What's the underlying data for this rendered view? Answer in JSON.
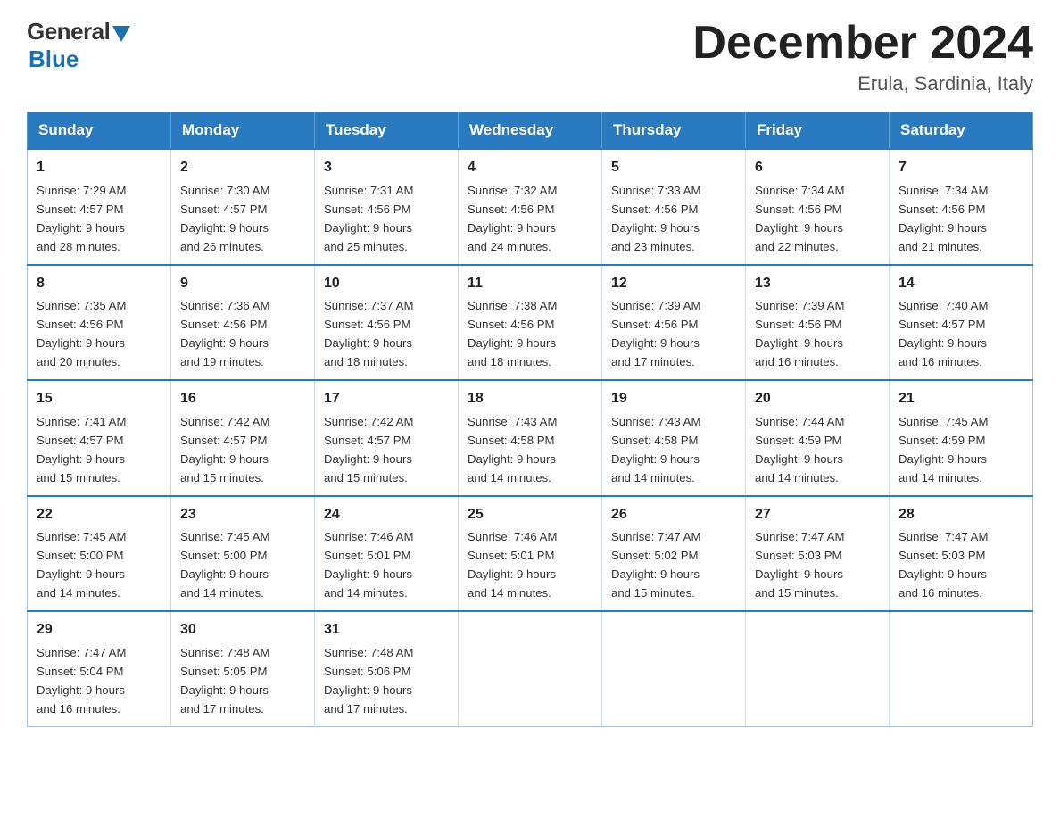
{
  "logo": {
    "general": "General",
    "blue": "Blue"
  },
  "header": {
    "title": "December 2024",
    "subtitle": "Erula, Sardinia, Italy"
  },
  "weekdays": [
    "Sunday",
    "Monday",
    "Tuesday",
    "Wednesday",
    "Thursday",
    "Friday",
    "Saturday"
  ],
  "weeks": [
    [
      {
        "day": "1",
        "sunrise": "7:29 AM",
        "sunset": "4:57 PM",
        "daylight": "9 hours and 28 minutes."
      },
      {
        "day": "2",
        "sunrise": "7:30 AM",
        "sunset": "4:57 PM",
        "daylight": "9 hours and 26 minutes."
      },
      {
        "day": "3",
        "sunrise": "7:31 AM",
        "sunset": "4:56 PM",
        "daylight": "9 hours and 25 minutes."
      },
      {
        "day": "4",
        "sunrise": "7:32 AM",
        "sunset": "4:56 PM",
        "daylight": "9 hours and 24 minutes."
      },
      {
        "day": "5",
        "sunrise": "7:33 AM",
        "sunset": "4:56 PM",
        "daylight": "9 hours and 23 minutes."
      },
      {
        "day": "6",
        "sunrise": "7:34 AM",
        "sunset": "4:56 PM",
        "daylight": "9 hours and 22 minutes."
      },
      {
        "day": "7",
        "sunrise": "7:34 AM",
        "sunset": "4:56 PM",
        "daylight": "9 hours and 21 minutes."
      }
    ],
    [
      {
        "day": "8",
        "sunrise": "7:35 AM",
        "sunset": "4:56 PM",
        "daylight": "9 hours and 20 minutes."
      },
      {
        "day": "9",
        "sunrise": "7:36 AM",
        "sunset": "4:56 PM",
        "daylight": "9 hours and 19 minutes."
      },
      {
        "day": "10",
        "sunrise": "7:37 AM",
        "sunset": "4:56 PM",
        "daylight": "9 hours and 18 minutes."
      },
      {
        "day": "11",
        "sunrise": "7:38 AM",
        "sunset": "4:56 PM",
        "daylight": "9 hours and 18 minutes."
      },
      {
        "day": "12",
        "sunrise": "7:39 AM",
        "sunset": "4:56 PM",
        "daylight": "9 hours and 17 minutes."
      },
      {
        "day": "13",
        "sunrise": "7:39 AM",
        "sunset": "4:56 PM",
        "daylight": "9 hours and 16 minutes."
      },
      {
        "day": "14",
        "sunrise": "7:40 AM",
        "sunset": "4:57 PM",
        "daylight": "9 hours and 16 minutes."
      }
    ],
    [
      {
        "day": "15",
        "sunrise": "7:41 AM",
        "sunset": "4:57 PM",
        "daylight": "9 hours and 15 minutes."
      },
      {
        "day": "16",
        "sunrise": "7:42 AM",
        "sunset": "4:57 PM",
        "daylight": "9 hours and 15 minutes."
      },
      {
        "day": "17",
        "sunrise": "7:42 AM",
        "sunset": "4:57 PM",
        "daylight": "9 hours and 15 minutes."
      },
      {
        "day": "18",
        "sunrise": "7:43 AM",
        "sunset": "4:58 PM",
        "daylight": "9 hours and 14 minutes."
      },
      {
        "day": "19",
        "sunrise": "7:43 AM",
        "sunset": "4:58 PM",
        "daylight": "9 hours and 14 minutes."
      },
      {
        "day": "20",
        "sunrise": "7:44 AM",
        "sunset": "4:59 PM",
        "daylight": "9 hours and 14 minutes."
      },
      {
        "day": "21",
        "sunrise": "7:45 AM",
        "sunset": "4:59 PM",
        "daylight": "9 hours and 14 minutes."
      }
    ],
    [
      {
        "day": "22",
        "sunrise": "7:45 AM",
        "sunset": "5:00 PM",
        "daylight": "9 hours and 14 minutes."
      },
      {
        "day": "23",
        "sunrise": "7:45 AM",
        "sunset": "5:00 PM",
        "daylight": "9 hours and 14 minutes."
      },
      {
        "day": "24",
        "sunrise": "7:46 AM",
        "sunset": "5:01 PM",
        "daylight": "9 hours and 14 minutes."
      },
      {
        "day": "25",
        "sunrise": "7:46 AM",
        "sunset": "5:01 PM",
        "daylight": "9 hours and 14 minutes."
      },
      {
        "day": "26",
        "sunrise": "7:47 AM",
        "sunset": "5:02 PM",
        "daylight": "9 hours and 15 minutes."
      },
      {
        "day": "27",
        "sunrise": "7:47 AM",
        "sunset": "5:03 PM",
        "daylight": "9 hours and 15 minutes."
      },
      {
        "day": "28",
        "sunrise": "7:47 AM",
        "sunset": "5:03 PM",
        "daylight": "9 hours and 16 minutes."
      }
    ],
    [
      {
        "day": "29",
        "sunrise": "7:47 AM",
        "sunset": "5:04 PM",
        "daylight": "9 hours and 16 minutes."
      },
      {
        "day": "30",
        "sunrise": "7:48 AM",
        "sunset": "5:05 PM",
        "daylight": "9 hours and 17 minutes."
      },
      {
        "day": "31",
        "sunrise": "7:48 AM",
        "sunset": "5:06 PM",
        "daylight": "9 hours and 17 minutes."
      },
      null,
      null,
      null,
      null
    ]
  ],
  "labels": {
    "sunrise": "Sunrise:",
    "sunset": "Sunset:",
    "daylight": "Daylight:"
  }
}
